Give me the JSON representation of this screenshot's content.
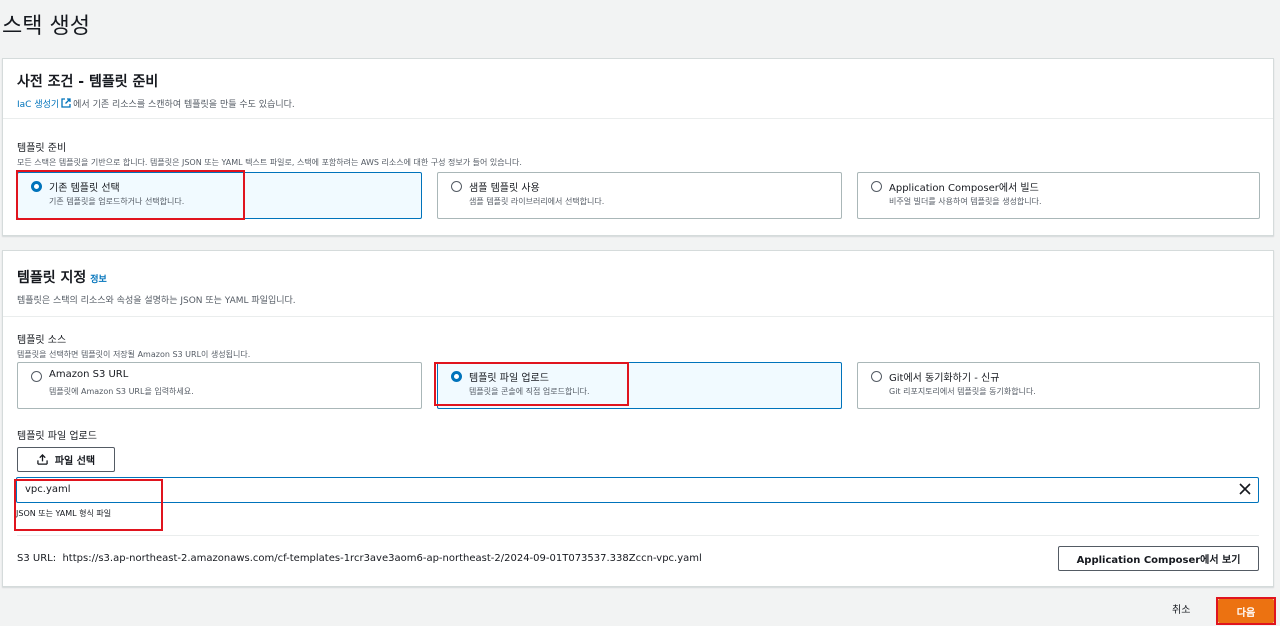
{
  "page": {
    "title": "스택 생성"
  },
  "prereq": {
    "title": "사전 조건 - 템플릿 준비",
    "iac_link": "IaC 생성기",
    "iac_desc": "에서 기존 리소스를 스캔하여 템플릿을 만들 수도 있습니다.",
    "field_label": "템플릿 준비",
    "field_desc": "모든 스택은 템플릿을 기반으로 합니다. 템플릿은 JSON 또는 YAML 텍스트 파일로, 스택에 포함하려는 AWS 리소스에 대한 구성 정보가 들어 있습니다.",
    "options": [
      {
        "title": "기존 템플릿 선택",
        "desc": "기존 템플릿을 업로드하거나 선택합니다.",
        "selected": true
      },
      {
        "title": "샘플 템플릿 사용",
        "desc": "샘플 템플릿 라이브러리에서 선택합니다.",
        "selected": false
      },
      {
        "title": "Application Composer에서 빌드",
        "desc": "비주얼 빌더를 사용하여 템플릿을 생성합니다.",
        "selected": false
      }
    ]
  },
  "spec": {
    "title": "템플릿 지정",
    "info": "정보",
    "subtitle": "템플릿은 스택의 리소스와 속성을 설명하는 JSON 또는 YAML 파일입니다.",
    "source_label": "템플릿 소스",
    "source_desc": "템플릿을 선택하면 템플릿이 저장될 Amazon S3 URL이 생성됩니다.",
    "options": [
      {
        "title": "Amazon S3 URL",
        "desc": "템플릿에 Amazon S3 URL을 입력하세요.",
        "selected": false
      },
      {
        "title": "템플릿 파일 업로드",
        "desc": "템플릿을 콘솔에 직접 업로드합니다.",
        "selected": true
      },
      {
        "title": "Git에서 동기화하기 - 신규",
        "desc": "Git 리포지토리에서 템플릿을 동기화합니다.",
        "selected": false
      }
    ],
    "upload_label": "템플릿 파일 업로드",
    "choose_file": "파일 선택",
    "file_name": "vpc.yaml",
    "file_hint": "JSON 또는 YAML 형식 파일",
    "s3_url_label": "S3 URL:",
    "s3_url": "https://s3.ap-northeast-2.amazonaws.com/cf-templates-1rcr3ave3aom6-ap-northeast-2/2024-09-01T073537.338Zccn-vpc.yaml",
    "view_composer": "Application Composer에서 보기"
  },
  "footer": {
    "cancel": "취소",
    "next": "다음"
  },
  "colors": {
    "accent": "#0073bb",
    "primary": "#ec7211",
    "highlight": "#e0141e"
  }
}
